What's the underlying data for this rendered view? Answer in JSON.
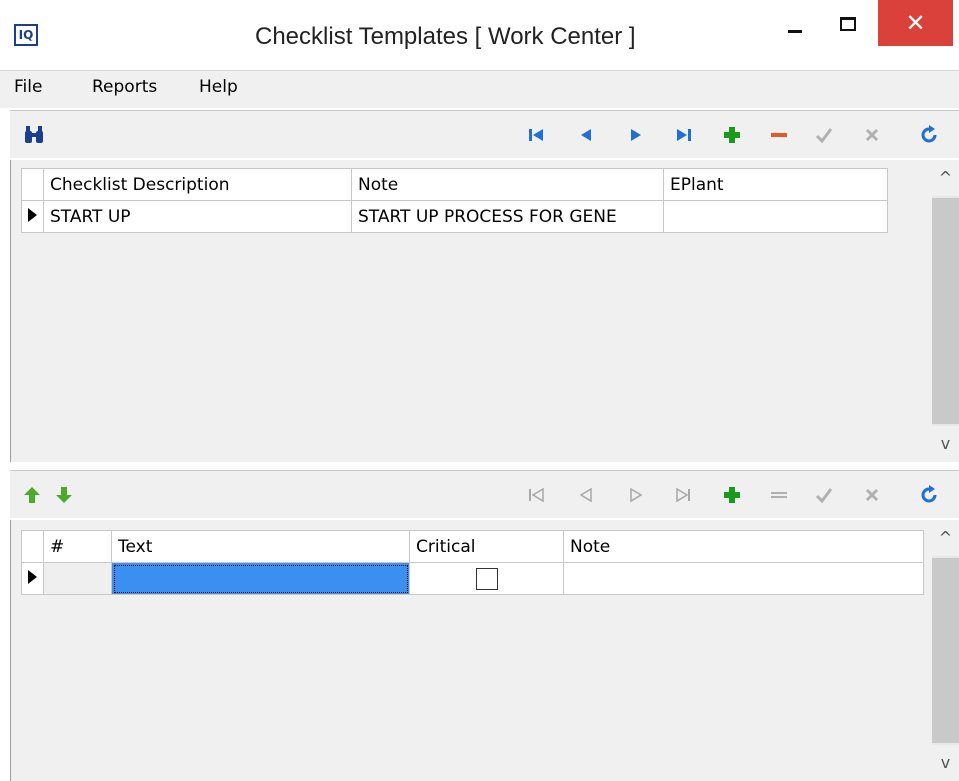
{
  "window": {
    "title": "Checklist Templates [ Work Center ]",
    "logo_text": "IQ",
    "close_glyph": "✕"
  },
  "menu": {
    "items": [
      "File",
      "Reports",
      "Help"
    ]
  },
  "toolbar_top": {
    "search_icon": "binoculars-icon",
    "nav_icons": [
      "first-record-icon",
      "prior-record-icon",
      "next-record-icon",
      "last-record-icon",
      "insert-icon",
      "delete-icon",
      "post-icon",
      "cancel-icon",
      "refresh-icon"
    ],
    "colors": {
      "nav": "#1f6fd6",
      "insert": "#1a9a1a",
      "delete": "#e05a2a",
      "disabled": "#b0b0b0",
      "refresh": "#1f6fd6"
    }
  },
  "toolbar_bottom": {
    "move_icons": [
      "move-up-icon",
      "move-down-icon"
    ],
    "nav_icons": [
      "first-record-icon",
      "prior-record-icon",
      "next-record-icon",
      "last-record-icon",
      "insert-icon",
      "delete-icon",
      "post-icon",
      "cancel-icon",
      "refresh-icon"
    ]
  },
  "checklist_grid": {
    "columns": [
      "Checklist Description",
      "Note",
      "EPlant"
    ],
    "rows": [
      {
        "description": "START UP",
        "note": "START UP PROCESS FOR GENE",
        "eplant": ""
      }
    ]
  },
  "detail_grid": {
    "columns": [
      "#",
      "Text",
      "Critical",
      "Note"
    ],
    "rows": [
      {
        "num": "",
        "text": "",
        "critical": false,
        "note": ""
      }
    ]
  },
  "scroll_glyphs": {
    "up": "^",
    "down": "v"
  }
}
